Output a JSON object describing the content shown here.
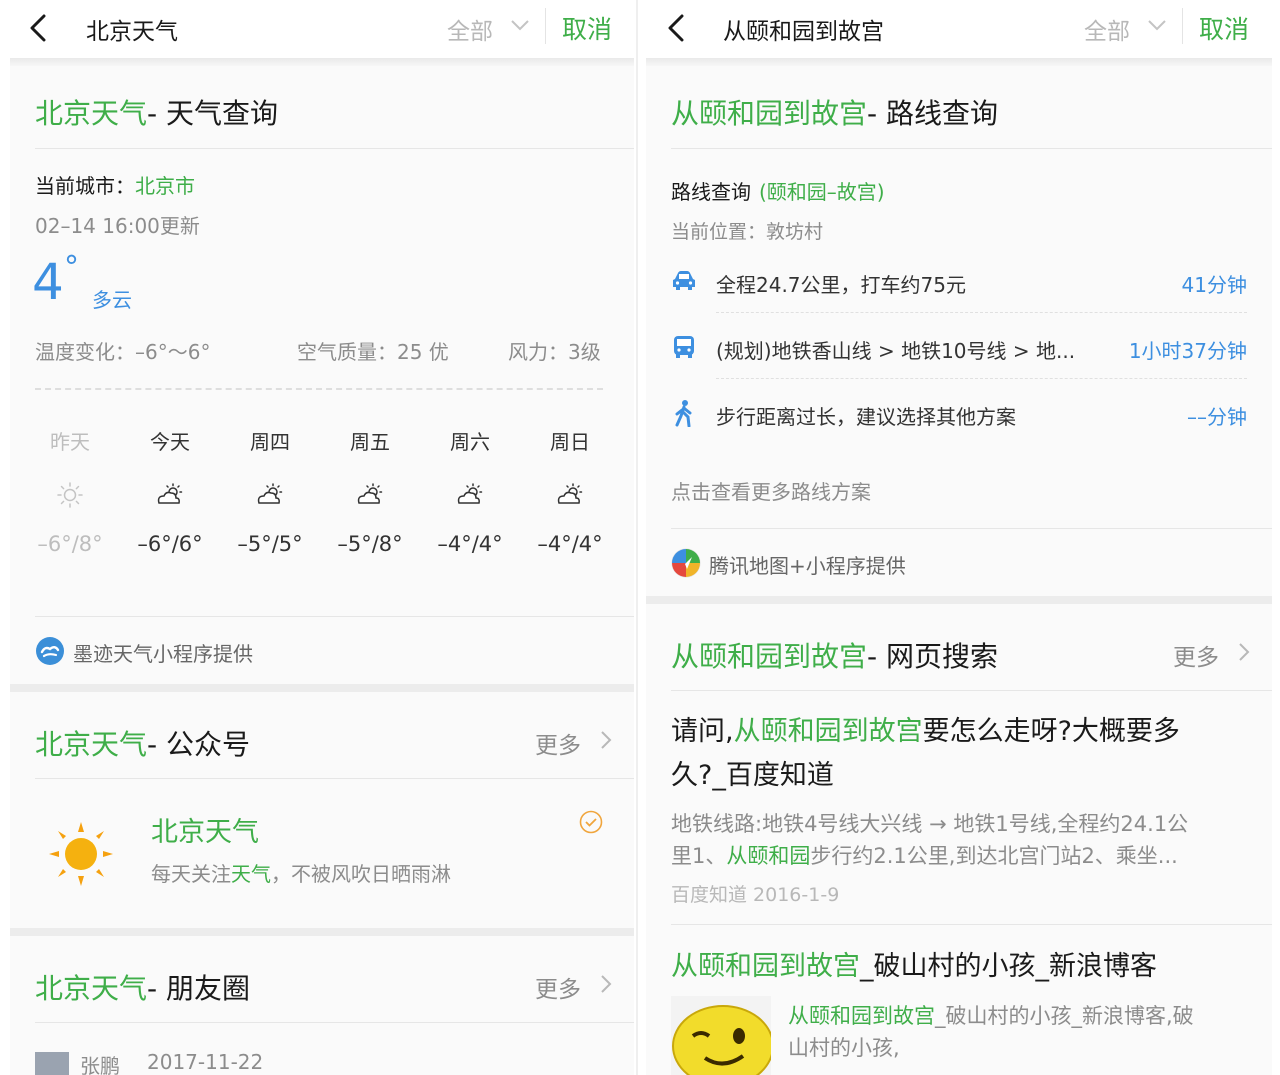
{
  "left": {
    "header": {
      "title": "北京天气",
      "filter": "全部",
      "cancel": "取消"
    },
    "weather": {
      "title_highlight": "北京天气",
      "title_rest": "- 天气查询",
      "city_label": "当前城市：",
      "city_value": "北京市",
      "updated": "02–14   16:00更新",
      "temp": "4",
      "degree": "°",
      "condition": "多云",
      "temp_change": "温度变化：–6°～6°",
      "air_quality": "空气质量：25 优",
      "wind": "风力：3级",
      "forecast": [
        {
          "day": "昨天",
          "icon": "sun-icon",
          "range": "–6°/8°",
          "faded": true
        },
        {
          "day": "今天",
          "icon": "partly-cloudy-icon",
          "range": "–6°/6°",
          "faded": false
        },
        {
          "day": "周四",
          "icon": "partly-cloudy-icon",
          "range": "–5°/5°",
          "faded": false
        },
        {
          "day": "周五",
          "icon": "partly-cloudy-icon",
          "range": "–5°/8°",
          "faded": false
        },
        {
          "day": "周六",
          "icon": "partly-cloudy-icon",
          "range": "–4°/4°",
          "faded": false
        },
        {
          "day": "周日",
          "icon": "partly-cloudy-icon",
          "range": "–4°/4°",
          "faded": false
        }
      ],
      "provider": "墨迹天气小程序提供",
      "provider_icon": "moji-logo-icon"
    },
    "official": {
      "title_highlight": "北京天气",
      "title_rest": "- 公众号",
      "more": "更多",
      "name": "北京天气",
      "desc_pre": "每天关注",
      "desc_hl": "天气",
      "desc_post": "，不被风吹日晒雨淋",
      "avatar_icon": "sun-avatar-icon",
      "verified_icon": "verified-check-icon"
    },
    "moments": {
      "title_highlight": "北京天气",
      "title_rest": "- 朋友圈",
      "more": "更多",
      "author": "张鹏",
      "date": "2017-11-22"
    }
  },
  "right": {
    "header": {
      "title": "从颐和园到故宫",
      "filter": "全部",
      "cancel": "取消"
    },
    "route": {
      "title_highlight": "从颐和园到故宫",
      "title_rest": "- 路线查询",
      "query_label": "路线查询",
      "query_value": "(颐和园–故宫)",
      "location": "当前位置：敦坊村",
      "options": [
        {
          "icon": "car-icon",
          "text": "全程24.7公里，打车约75元",
          "time": "41分钟"
        },
        {
          "icon": "bus-icon",
          "text": "(规划)地铁香山线 > 地铁10号线 > 地...",
          "time": "1小时37分钟"
        },
        {
          "icon": "walk-icon",
          "text": "步行距离过长，建议选择其他方案",
          "time": "––分钟"
        }
      ],
      "more_routes": "点击查看更多路线方案",
      "provider": "腾讯地图+小程序提供",
      "provider_icon": "tencent-map-logo-icon"
    },
    "web": {
      "title_highlight": "从颐和园到故宫",
      "title_rest": "- 网页搜索",
      "more": "更多",
      "results": [
        {
          "title_pre": "请问,",
          "title_hl": "从颐和园到故宫",
          "title_post1": "要怎么走呀?大概要多",
          "title_post2": "久?_百度知道",
          "snippet_line1": "地铁线路:地铁4号线大兴线 → 地铁1号线,全程约24.1公",
          "snippet_pre": "里1、",
          "snippet_hl": "从颐和园",
          "snippet_post": "步行约2.1公里,到达北宫门站2、乘坐...",
          "source": "百度知道 2016-1-9"
        },
        {
          "title_hl": "从颐和园到故宫",
          "title_post": "_破山村的小孩_新浪博客",
          "snippet_hl": "从颐和园到故宫",
          "snippet_post": "_破山村的小孩_新浪博客,破",
          "snippet_line2": "山村的小孩,",
          "thumb_icon": "wink-face-thumbnail"
        }
      ]
    }
  }
}
